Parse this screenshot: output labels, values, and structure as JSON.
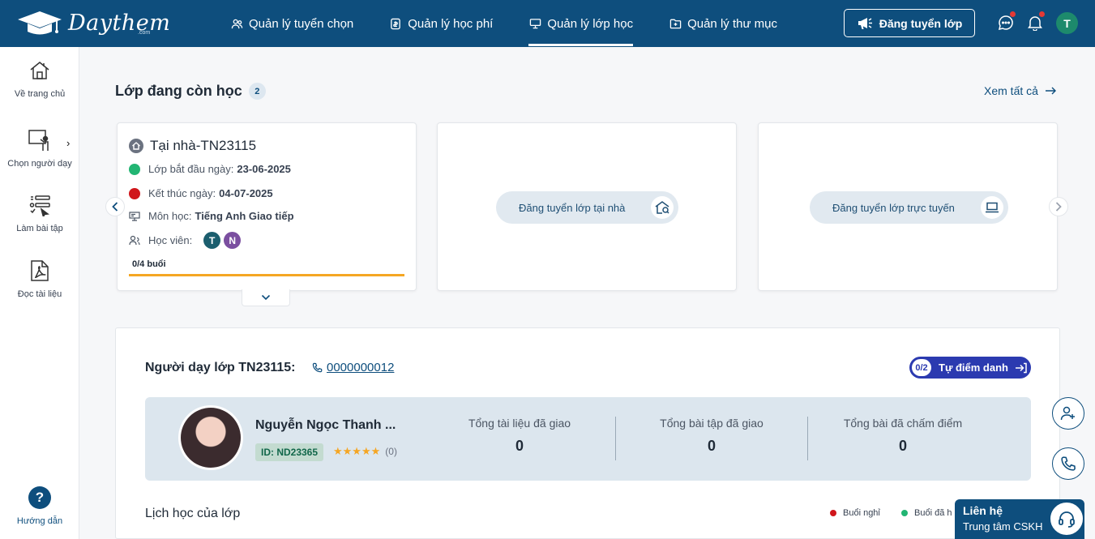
{
  "brand": {
    "name": "Daythem",
    "suffix": ".com"
  },
  "nav": [
    {
      "label": "Quản lý tuyển chọn",
      "icon": "users-icon"
    },
    {
      "label": "Quản lý học phí",
      "icon": "fee-icon"
    },
    {
      "label": "Quản lý lớp học",
      "icon": "classroom-icon",
      "active": true
    },
    {
      "label": "Quản lý thư mục",
      "icon": "folder-icon"
    }
  ],
  "header": {
    "post_button": "Đăng tuyển lớp",
    "avatar_initial": "T"
  },
  "sidebar": {
    "items": [
      {
        "label": "Về trang chủ",
        "icon": "home-icon"
      },
      {
        "label": "Chọn người dạy",
        "icon": "teacher-board-icon"
      },
      {
        "label": "Làm bài tập",
        "icon": "exercise-icon"
      },
      {
        "label": "Đọc tài liệu",
        "icon": "pdf-icon"
      }
    ],
    "help": "Hướng dẫn"
  },
  "section": {
    "title": "Lớp đang còn học",
    "count": "2",
    "see_all": "Xem tất cả"
  },
  "class_card": {
    "title": "Tại nhà-TN23115",
    "start_label": "Lớp bắt đầu ngày:",
    "start_date": "23-06-2025",
    "end_label": "Kết thúc ngày:",
    "end_date": "04-07-2025",
    "subject_label": "Môn học:",
    "subject": "Tiếng Anh Giao tiếp",
    "students_label": "Học viên:",
    "students": [
      {
        "initial": "T",
        "color": "#1b5e6e"
      },
      {
        "initial": "N",
        "color": "#7b4fa0"
      }
    ],
    "progress_label": "0/4 buổi",
    "progress": 1.0
  },
  "post_home": "Đăng tuyển lớp tại nhà",
  "post_online": "Đăng tuyển lớp trực tuyến",
  "teacher_panel": {
    "title": "Người dạy lớp TN23115:",
    "phone": "0000000012",
    "attend_count": "0/2",
    "attend_label": "Tự điểm danh",
    "teacher_name": "Nguyễn Ngọc Thanh ...",
    "teacher_id": "ID: ND23365",
    "stars": "★★★★★",
    "rating_count": "(0)",
    "stats": [
      {
        "label": "Tổng tài liệu đã giao",
        "value": "0"
      },
      {
        "label": "Tổng bài tập đã giao",
        "value": "0"
      },
      {
        "label": "Tổng bài đã chấm điểm",
        "value": "0"
      }
    ],
    "schedule_title": "Lịch học của lớp",
    "legend": [
      {
        "label": "Buổi nghỉ",
        "color": "#d0161b"
      },
      {
        "label": "Buổi đã h",
        "color": "#22b573"
      }
    ]
  },
  "contact": {
    "line1": "Liên hệ",
    "line2": "Trung tâm CSKH"
  },
  "colors": {
    "primary": "#0e4e7d",
    "accent": "#f5a623",
    "attend": "#2b3ab0"
  }
}
